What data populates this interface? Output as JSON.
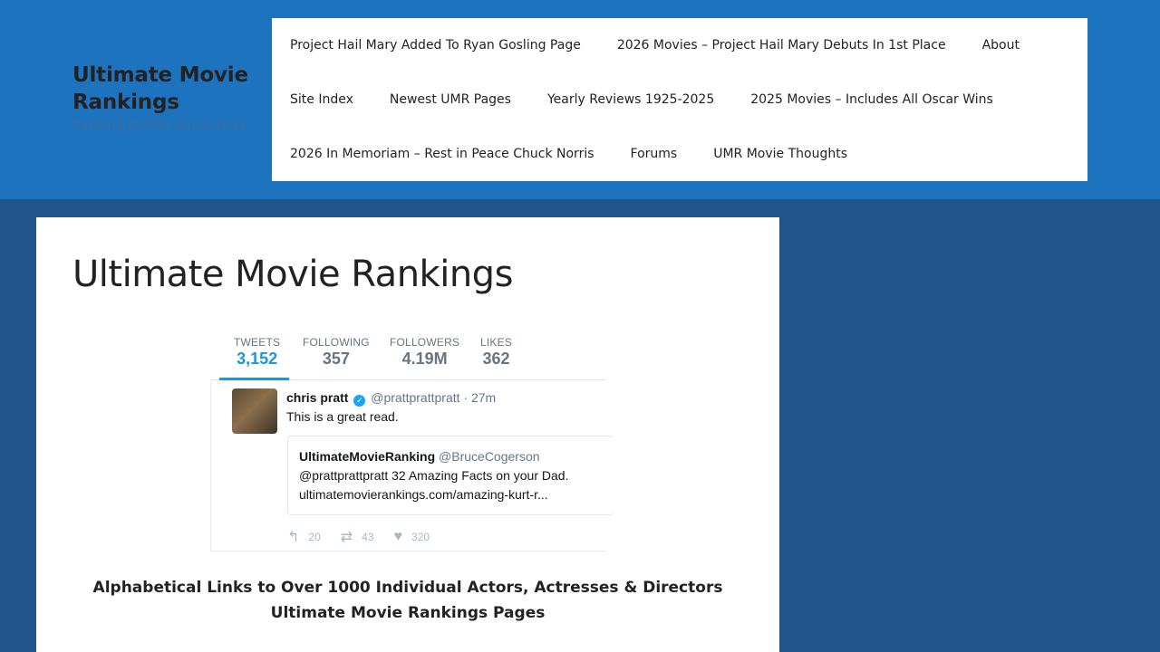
{
  "site": {
    "title": "Ultimate Movie Rankings",
    "tagline": "Ranking Movies Since 2011"
  },
  "nav": {
    "row1": [
      "Project Hail Mary Added To Ryan Gosling Page",
      "2026 Movies – Project Hail Mary Debuts In 1st Place",
      "About"
    ],
    "row2": [
      "Site Index",
      "Newest UMR Pages",
      "Yearly Reviews 1925-2025",
      "2025 Movies – Includes All Oscar Wins"
    ],
    "row3": [
      "2026 In Memoriam – Rest in Peace Chuck Norris",
      "Forums",
      "UMR Movie Thoughts"
    ]
  },
  "main": {
    "title": "Ultimate Movie Rankings",
    "bottom_text": "Alphabetical Links to Over 1000 Individual Actors, Actresses & Directors Ultimate Movie Rankings Pages"
  },
  "tweet": {
    "stats": [
      {
        "label": "TWEETS",
        "value": "3,152"
      },
      {
        "label": "FOLLOWING",
        "value": "357"
      },
      {
        "label": "FOLLOWERS",
        "value": "4.19M"
      },
      {
        "label": "LIKES",
        "value": "362"
      }
    ],
    "author_name": "chris pratt",
    "author_handle": "@prattprattpratt · 27m",
    "text": "This is a great read.",
    "quote": {
      "name": "UltimateMovieRanking",
      "handle": "@BruceCogerson",
      "line1": "@prattprattpratt 32 Amazing Facts on your Dad.",
      "line2": "ultimatemovierankings.com/amazing-kurt-r..."
    },
    "actions": {
      "replies": "20",
      "retweets": "43",
      "likes": "320"
    },
    "icons": [
      "reply-icon",
      "retweet-icon",
      "heart-icon",
      "verified-icon"
    ]
  },
  "colors": {
    "header_bg": "#1e73be",
    "page_bg": "#21558a",
    "twitter_blue": "#1b95e0"
  }
}
